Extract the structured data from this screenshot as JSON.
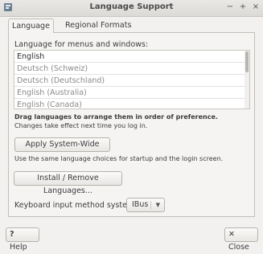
{
  "window": {
    "title": "Language Support",
    "controls": {
      "minimize": "−",
      "maximize": "+",
      "close": "×"
    }
  },
  "tabs": [
    {
      "label": "Language",
      "active": true
    },
    {
      "label": "Regional Formats",
      "active": false
    }
  ],
  "language_panel": {
    "label": "Language for menus and windows:",
    "languages": [
      "English",
      "Deutsch (Schweiz)",
      "Deutsch (Deutschland)",
      "English (Australia)",
      "English (Canada)"
    ],
    "hint_bold": "Drag languages to arrange them in order of preference.",
    "hint": "Changes take effect next time you log in.",
    "apply_button": "Apply System-Wide",
    "apply_description": "Use the same language choices for startup and the login screen.",
    "install_button": "Install / Remove Languages...",
    "keyboard_label": "Keyboard input method system:",
    "keyboard_value": "IBus"
  },
  "footer": {
    "help_label": "Help",
    "close_label": "Close",
    "help_glyph": "?",
    "close_glyph": "✕"
  },
  "icons": {
    "app": "language-app-icon",
    "dropdown": "chevron-down-icon"
  }
}
